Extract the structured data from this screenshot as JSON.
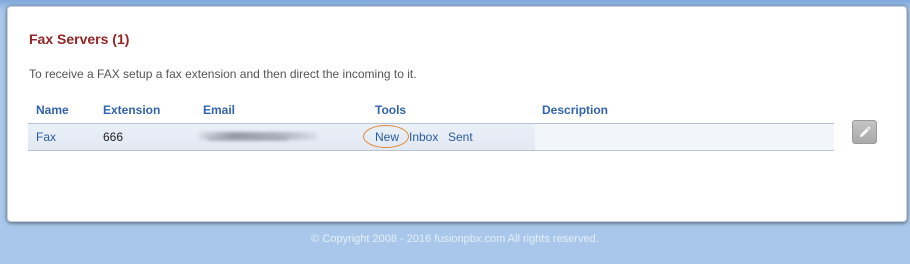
{
  "page": {
    "title": "Fax Servers (1)",
    "instructions": "To receive a FAX setup a fax extension and then direct the incoming to it."
  },
  "table": {
    "columns": [
      "Name",
      "Extension",
      "Email",
      "Tools",
      "Description"
    ],
    "rows": [
      {
        "name": "Fax",
        "extension": "666",
        "email": "",
        "tools": [
          "New",
          "Inbox",
          "Sent"
        ],
        "description": ""
      }
    ]
  },
  "icons": {
    "edit": "pencil-icon"
  },
  "colors": {
    "title": "#952424",
    "header": "#3164ad",
    "link": "#2a5a9e",
    "highlight": "#e08a3a",
    "background": "#a9c7ea"
  },
  "footer": {
    "text": "© Copyright 2008 - 2016 fusionpbx.com All rights reserved."
  }
}
